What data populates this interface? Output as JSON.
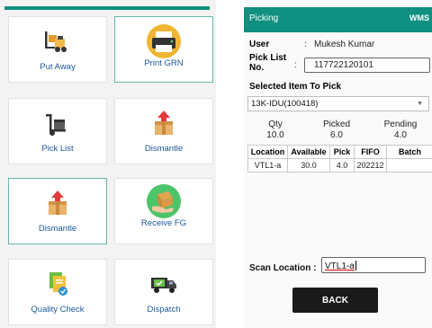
{
  "menu": {
    "tiles": [
      {
        "label": "Put Away",
        "icon": "forklift-icon"
      },
      {
        "label": "Print GRN",
        "icon": "printer-icon"
      },
      {
        "label": "Pick List",
        "icon": "hand-truck-icon"
      },
      {
        "label": "Dismantle",
        "icon": "box-arrow-up-icon"
      },
      {
        "label": "Dismantle",
        "icon": "box-arrow-up-icon"
      },
      {
        "label": "Receive FG",
        "icon": "box-hand-icon"
      },
      {
        "label": "Quality Check",
        "icon": "quality-docs-icon"
      },
      {
        "label": "Dispatch",
        "icon": "delivery-truck-icon"
      }
    ]
  },
  "picking": {
    "title": "Picking",
    "app_badge": "WMS",
    "user_label": "User",
    "user_sep": ":",
    "user_value": "Mukesh Kumar",
    "pick_list_label_1": "Pick List",
    "pick_list_label_2": "No.",
    "pick_list_sep": ":",
    "pick_list_value": "117722120101",
    "selected_label": "Selected Item To Pick",
    "selected_item": "13K-IDU(100418)",
    "qty_label": "Qty",
    "qty_value": "10.0",
    "picked_label": "Picked",
    "picked_value": "6.0",
    "pending_label": "Pending",
    "pending_value": "4.0",
    "table": {
      "headers": [
        "Location",
        "Available",
        "Pick",
        "FIFO",
        "Batch"
      ],
      "rows": [
        [
          "VTL1-a",
          "30.0",
          "4.0",
          "202212",
          ""
        ]
      ]
    },
    "scan_label": "Scan Location :",
    "scan_value": "VTL1-a",
    "back_label": "BACK"
  },
  "colors": {
    "accent": "#109080",
    "tile_text": "#1d5796",
    "button": "#1a1a1a"
  }
}
